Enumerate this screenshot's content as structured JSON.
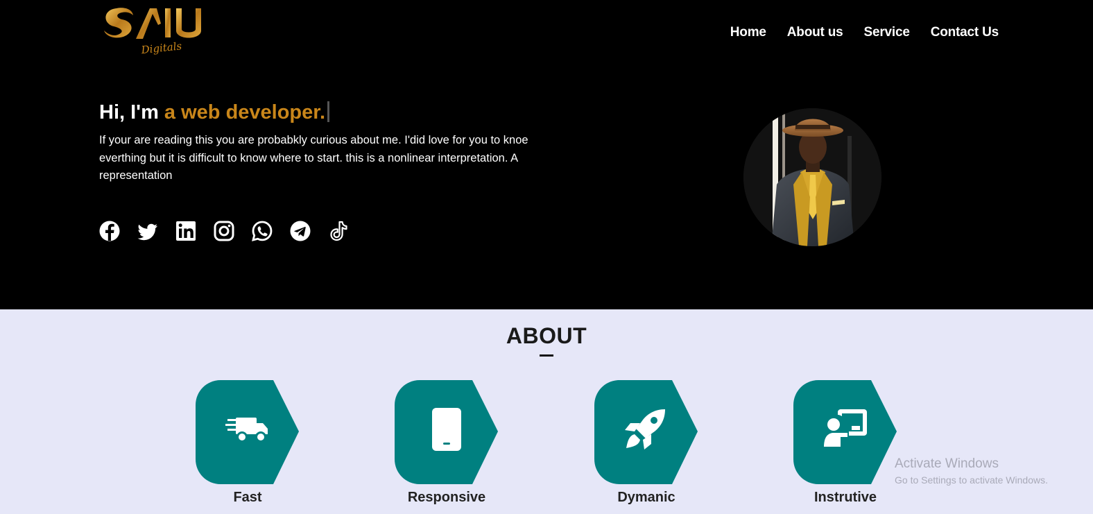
{
  "brand": {
    "logo_text": "SAIU",
    "logo_subtext": "Digitals"
  },
  "nav": {
    "items": [
      "Home",
      "About us",
      "Service",
      "Contact Us"
    ]
  },
  "hero": {
    "greeting_prefix": "Hi, I'm",
    "greeting_accent": "a web developer.",
    "bio": "If your are reading this you are probabkly curious about me. I'did love for you to knoe everthing but it is difficult to know where to start. this is a nonlinear interpretation. A representation",
    "socials": [
      "facebook-icon",
      "twitter-icon",
      "linkedin-icon",
      "instagram-icon",
      "whatsapp-icon",
      "telegram-icon",
      "tiktok-icon"
    ]
  },
  "about": {
    "title": "ABOUT",
    "features": [
      {
        "label": "Fast",
        "icon": "truck-fast-icon"
      },
      {
        "label": "Responsive",
        "icon": "mobile-icon"
      },
      {
        "label": "Dymanic",
        "icon": "rocket-icon"
      },
      {
        "label": "Instrutive",
        "icon": "teacher-board-icon"
      }
    ]
  },
  "watermark": {
    "line1": "Activate Windows",
    "line2": "Go to Settings to activate Windows."
  },
  "colors": {
    "accent": "#c9861a",
    "teal": "#008080",
    "hero_bg": "#000000",
    "about_bg": "#e6e7f8"
  }
}
